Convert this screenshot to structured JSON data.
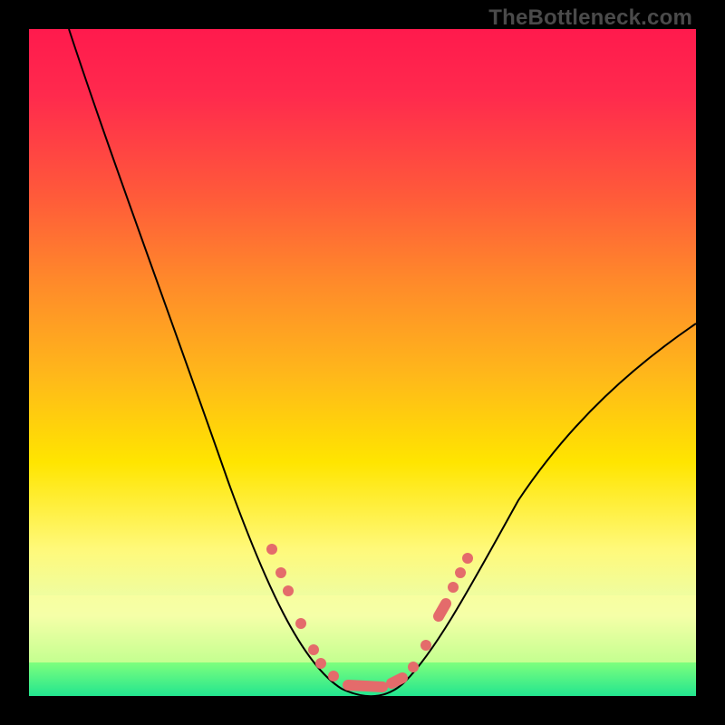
{
  "watermark": "TheBottleneck.com",
  "colors": {
    "frame": "#000000",
    "gradient_top": "#ff1a4d",
    "gradient_bottom": "#22e58f",
    "curve": "#000000",
    "markers": "#e46b6b"
  },
  "chart_data": {
    "type": "line",
    "title": "",
    "xlabel": "",
    "ylabel": "",
    "xlim": [
      0,
      100
    ],
    "ylim": [
      0,
      100
    ],
    "series": [
      {
        "name": "bottleneck-curve",
        "x": [
          6,
          10,
          15,
          20,
          25,
          30,
          35,
          38,
          40,
          43,
          46,
          48,
          50,
          52,
          55,
          58,
          62,
          66,
          72,
          80,
          90,
          100
        ],
        "y": [
          100,
          90,
          78,
          64,
          50,
          36,
          24,
          16,
          10,
          5,
          2,
          0.5,
          0,
          0.5,
          2,
          6,
          12,
          20,
          30,
          40,
          49,
          56
        ]
      }
    ],
    "markers": {
      "name": "highlighted-points",
      "x": [
        36,
        38,
        39,
        41,
        43,
        44,
        46,
        48,
        50,
        52,
        54,
        56,
        58,
        60,
        62
      ],
      "y": [
        22,
        18,
        15,
        10,
        6,
        4,
        2,
        1,
        0.5,
        1,
        2,
        4,
        8,
        12,
        18
      ]
    },
    "bands": [
      {
        "name": "pale-yellow-band",
        "y_from": 5,
        "y_to": 15
      }
    ]
  }
}
